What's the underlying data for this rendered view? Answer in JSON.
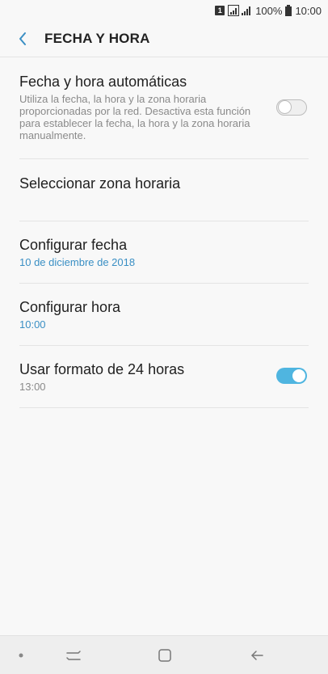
{
  "status_bar": {
    "sim_label": "1",
    "battery_percent": "100%",
    "time": "10:00",
    "icons": [
      "sim-icon",
      "signal-icon",
      "battery-icon"
    ]
  },
  "header": {
    "title": "FECHA Y HORA",
    "back_icon": "chevron-left-icon"
  },
  "settings": {
    "auto_datetime": {
      "title": "Fecha y hora automáticas",
      "description": "Utiliza la fecha, la hora y la zona horaria proporcionadas por la red. Desactiva esta función para establecer la fecha, la hora y la zona horaria manualmente.",
      "enabled": false
    },
    "timezone": {
      "title": "Seleccionar zona horaria"
    },
    "set_date": {
      "title": "Configurar fecha",
      "value": "10 de diciembre de 2018"
    },
    "set_time": {
      "title": "Configurar hora",
      "value": "10:00"
    },
    "format_24h": {
      "title": "Usar formato de 24 horas",
      "value": "13:00",
      "enabled": true
    }
  },
  "colors": {
    "accent": "#3a8fc4",
    "toggle_on": "#4fb5e0",
    "background": "#f8f8f8"
  },
  "nav_bar": {
    "icons": [
      "dot-icon",
      "recents-icon",
      "home-icon",
      "back-arrow-icon"
    ]
  }
}
